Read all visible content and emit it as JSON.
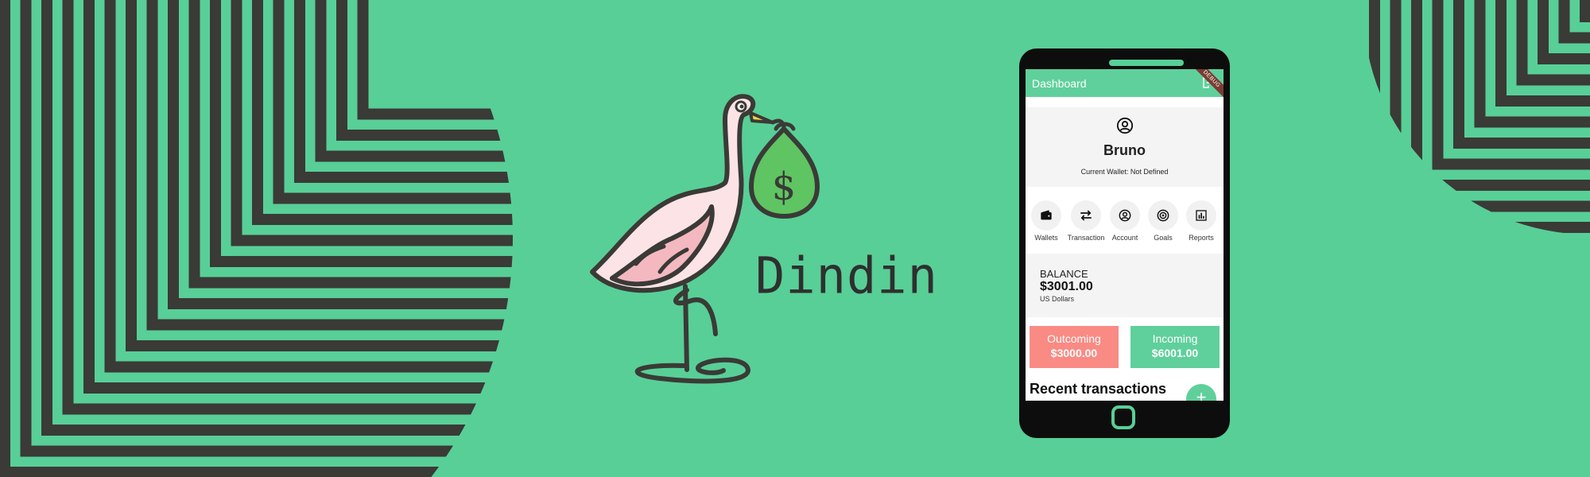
{
  "colors": {
    "background": "#58cf97",
    "stripes": "#3a3a36",
    "accent_green": "#5fd09b",
    "outcoming_red": "#f98b84",
    "debug_ribbon": "#7a3b32"
  },
  "brand": {
    "name": "Dindin",
    "logo": "stork-carrying-money-bag-icon",
    "money_symbol": "$"
  },
  "app": {
    "appbar": {
      "title": "Dashboard",
      "logout_icon": "logout-icon",
      "debug_label": "DEBUG"
    },
    "profile": {
      "avatar_icon": "user-circle-icon",
      "name": "Bruno",
      "wallet_text": "Current Wallet: Not Defined"
    },
    "menu": [
      {
        "label": "Wallets",
        "icon": "wallet-icon"
      },
      {
        "label": "Transaction",
        "icon": "swap-arrows-icon"
      },
      {
        "label": "Account",
        "icon": "account-circle-icon"
      },
      {
        "label": "Goals",
        "icon": "target-icon"
      },
      {
        "label": "Reports",
        "icon": "bar-chart-icon"
      }
    ],
    "balance": {
      "title": "BALANCE",
      "value": "$3001.00",
      "currency": "US Dollars"
    },
    "outcoming": {
      "label": "Outcoming",
      "value": "$3000.00"
    },
    "incoming": {
      "label": "Incoming",
      "value": "$6001.00"
    },
    "recent_title": "Recent transactions",
    "fab_label": "+"
  }
}
